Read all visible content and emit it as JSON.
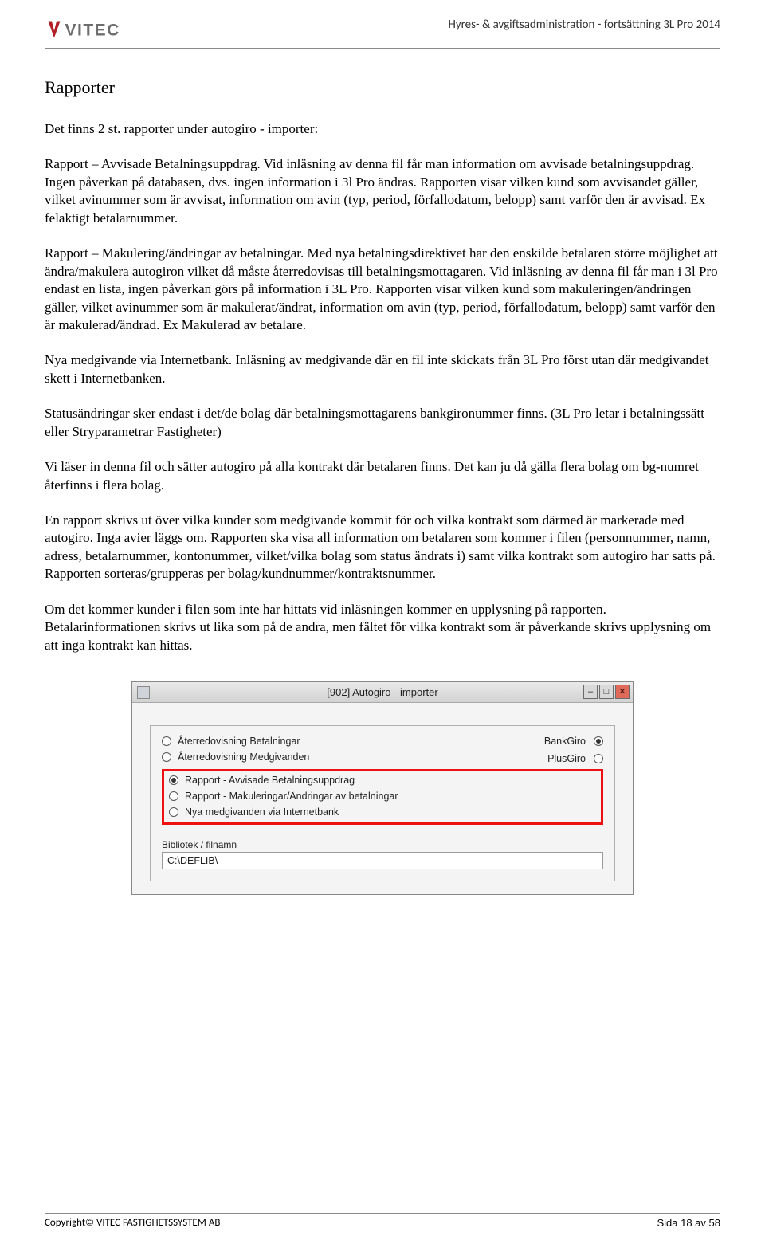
{
  "header": {
    "brand": "VITEC",
    "right_text": "Hyres- & avgiftsadministration - fortsättning 3L Pro 2014"
  },
  "content": {
    "heading": "Rapporter",
    "p1": "Det finns 2 st. rapporter under autogiro - importer:",
    "p2": "Rapport – Avvisade Betalningsuppdrag. Vid inläsning av denna fil får man information om avvisade betalningsuppdrag. Ingen påverkan på databasen, dvs. ingen information i 3l Pro ändras. Rapporten visar vilken kund som avvisandet gäller, vilket avinummer som är avvisat, information om avin (typ, period, förfallodatum, belopp) samt varför den är avvisad. Ex felaktigt betalarnummer.",
    "p3": "Rapport – Makulering/ändringar av betalningar. Med nya betalningsdirektivet har den enskilde betalaren större möjlighet att ändra/makulera autogiron vilket då måste återredovisas till betalningsmottagaren. Vid inläsning av denna fil får man i 3l Pro endast en lista, ingen påverkan görs på information i 3L Pro. Rapporten visar vilken kund som makuleringen/ändringen gäller, vilket avinummer som är makulerat/ändrat, information om avin (typ, period, förfallodatum, belopp) samt varför den är makulerad/ändrad. Ex Makulerad av betalare.",
    "p4": "Nya medgivande via Internetbank. Inläsning av medgivande där en fil inte skickats från 3L Pro först utan där medgivandet skett i Internetbanken.",
    "p5": "Statusändringar sker endast i det/de bolag där betalningsmottagarens bankgironummer finns. (3L Pro letar i betalningssätt eller Stryparametrar Fastigheter)",
    "p6": "Vi läser in denna fil och sätter autogiro på alla kontrakt där betalaren finns. Det kan ju då gälla flera bolag om bg-numret återfinns i flera bolag.",
    "p7": "En rapport skrivs ut över vilka kunder som medgivande kommit för och vilka kontrakt som därmed är markerade med autogiro. Inga avier läggs om. Rapporten ska visa all information om betalaren som kommer i filen (personnummer, namn, adress, betalarnummer, kontonummer, vilket/vilka bolag som status ändrats i) samt vilka kontrakt som autogiro har satts på. Rapporten sorteras/grupperas per bolag/kundnummer/kontraktsnummer.",
    "p8": "Om det kommer kunder i filen som inte har hittats vid inläsningen kommer en upplysning på rapporten. Betalarinformationen skrivs ut lika som på de andra, men fältet för vilka kontrakt som är påverkande skrivs upplysning om att inga kontrakt kan hittas."
  },
  "window": {
    "title": "[902]  Autogiro - importer",
    "radios_left": [
      {
        "label": "Återredovisning Betalningar",
        "selected": false
      },
      {
        "label": "Återredovisning Medgivanden",
        "selected": false
      },
      {
        "label": "Rapport - Avvisade Betalningsuppdrag",
        "selected": true
      },
      {
        "label": "Rapport - Makuleringar/Ändringar av betalningar",
        "selected": false
      },
      {
        "label": "Nya medgivanden via Internetbank",
        "selected": false
      }
    ],
    "radios_right": [
      {
        "label": "BankGiro",
        "selected": true
      },
      {
        "label": "PlusGiro",
        "selected": false
      }
    ],
    "path_label": "Bibliotek / filnamn",
    "path_value": "C:\\DEFLIB\\"
  },
  "footer": {
    "left_prefix": "Copyright© ",
    "left_company": "VITEC FASTIGHETSSYSTEM AB",
    "right": "Sida 18 av 58"
  }
}
